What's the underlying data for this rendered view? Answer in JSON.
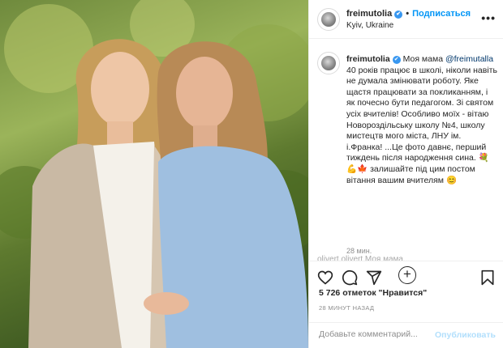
{
  "header": {
    "username": "freimutolia",
    "follow_label": "Подписаться",
    "location": "Kyiv, Ukraine"
  },
  "caption": {
    "username": "freimutolia",
    "lead": "Моя мама",
    "mention": "@freimutalla",
    "body": "40 років працює в школі, ніколи навіть не думала змінювати роботу. Яке щастя працювати за покликанням, і як почесно бути педагогом. Зі святом усіх вчителів! Особливо моїх - вітаю Новороздільську школу №4, школу мистецтв мого міста, ЛНУ ім. і.Франка! ...Це фото давнє, перший тиждень після народження сина. 💐",
    "body_end": "💪🍁 залишайте під цим постом вітання вашим вчителям 😊",
    "time_ago": "28 мин."
  },
  "next_comment": "olivert.olivert  Моя мама...",
  "likes": "5 726 отметок \"Нравится\"",
  "posted": "28 МИНУТ НАЗАД",
  "comment_box": {
    "placeholder": "Добавьте комментарий...",
    "publish_label": "Опубликовать"
  },
  "colors": {
    "accent": "#0095f6",
    "verified": "#3897f0",
    "publish_disabled": "#b2dffc"
  },
  "icons": [
    "heart-icon",
    "comment-icon",
    "share-icon",
    "bookmark-icon",
    "plus-icon",
    "more-icon",
    "verified-icon"
  ]
}
